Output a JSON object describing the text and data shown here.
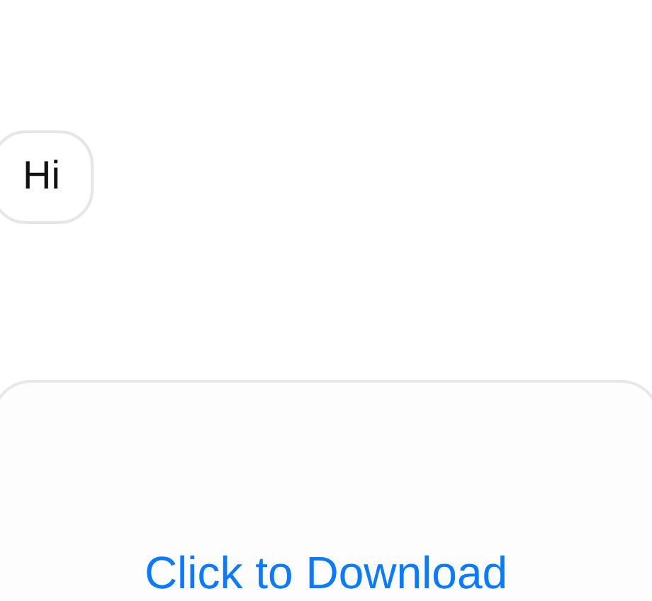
{
  "messages": [
    {
      "kind": "bubble",
      "text": "Hi"
    }
  ],
  "attachment": {
    "link": "Click to Download"
  }
}
